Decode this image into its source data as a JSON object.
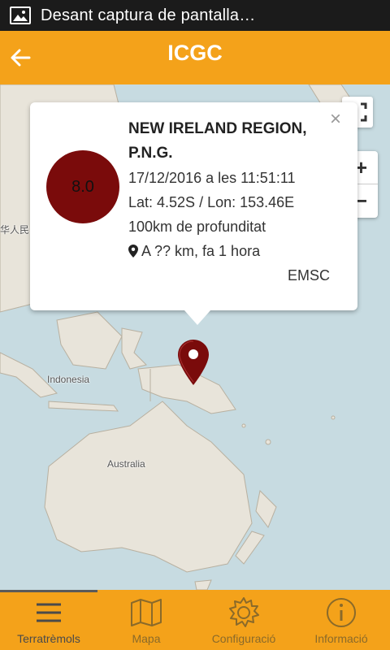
{
  "status_bar": {
    "notification_text": "Desant captura de pantalla…",
    "icon": "image-icon"
  },
  "app_bar": {
    "title": "ICGC",
    "back_icon": "arrow-left-icon"
  },
  "map": {
    "labels": {
      "china": "华人民",
      "indonesia": "Indonesia",
      "australia": "Australia"
    }
  },
  "popup": {
    "magnitude": "8.0",
    "region_line1": "NEW IRELAND REGION,",
    "region_line2": "P.N.G.",
    "datetime": "17/12/2016 a les 11:51:11",
    "coords": "Lat: 4.52S / Lon: 153.46E",
    "depth": "100km de profunditat",
    "distance": "A ?? km, fa 1 hora",
    "source": "EMSC",
    "close_label": "×"
  },
  "zoom": {
    "in_label": "+",
    "out_label": "−"
  },
  "bottom_nav": {
    "active_index": 0,
    "tabs": [
      {
        "label": "Terratrèmols",
        "icon": "menu-icon"
      },
      {
        "label": "Mapa",
        "icon": "map-icon"
      },
      {
        "label": "Configuració",
        "icon": "gear-icon"
      },
      {
        "label": "Informació",
        "icon": "info-icon"
      }
    ]
  },
  "colors": {
    "accent": "#f4a21a",
    "magnitude": "#7a0b0b",
    "sea": "#c7dbe1",
    "land": "#e8e4da"
  }
}
